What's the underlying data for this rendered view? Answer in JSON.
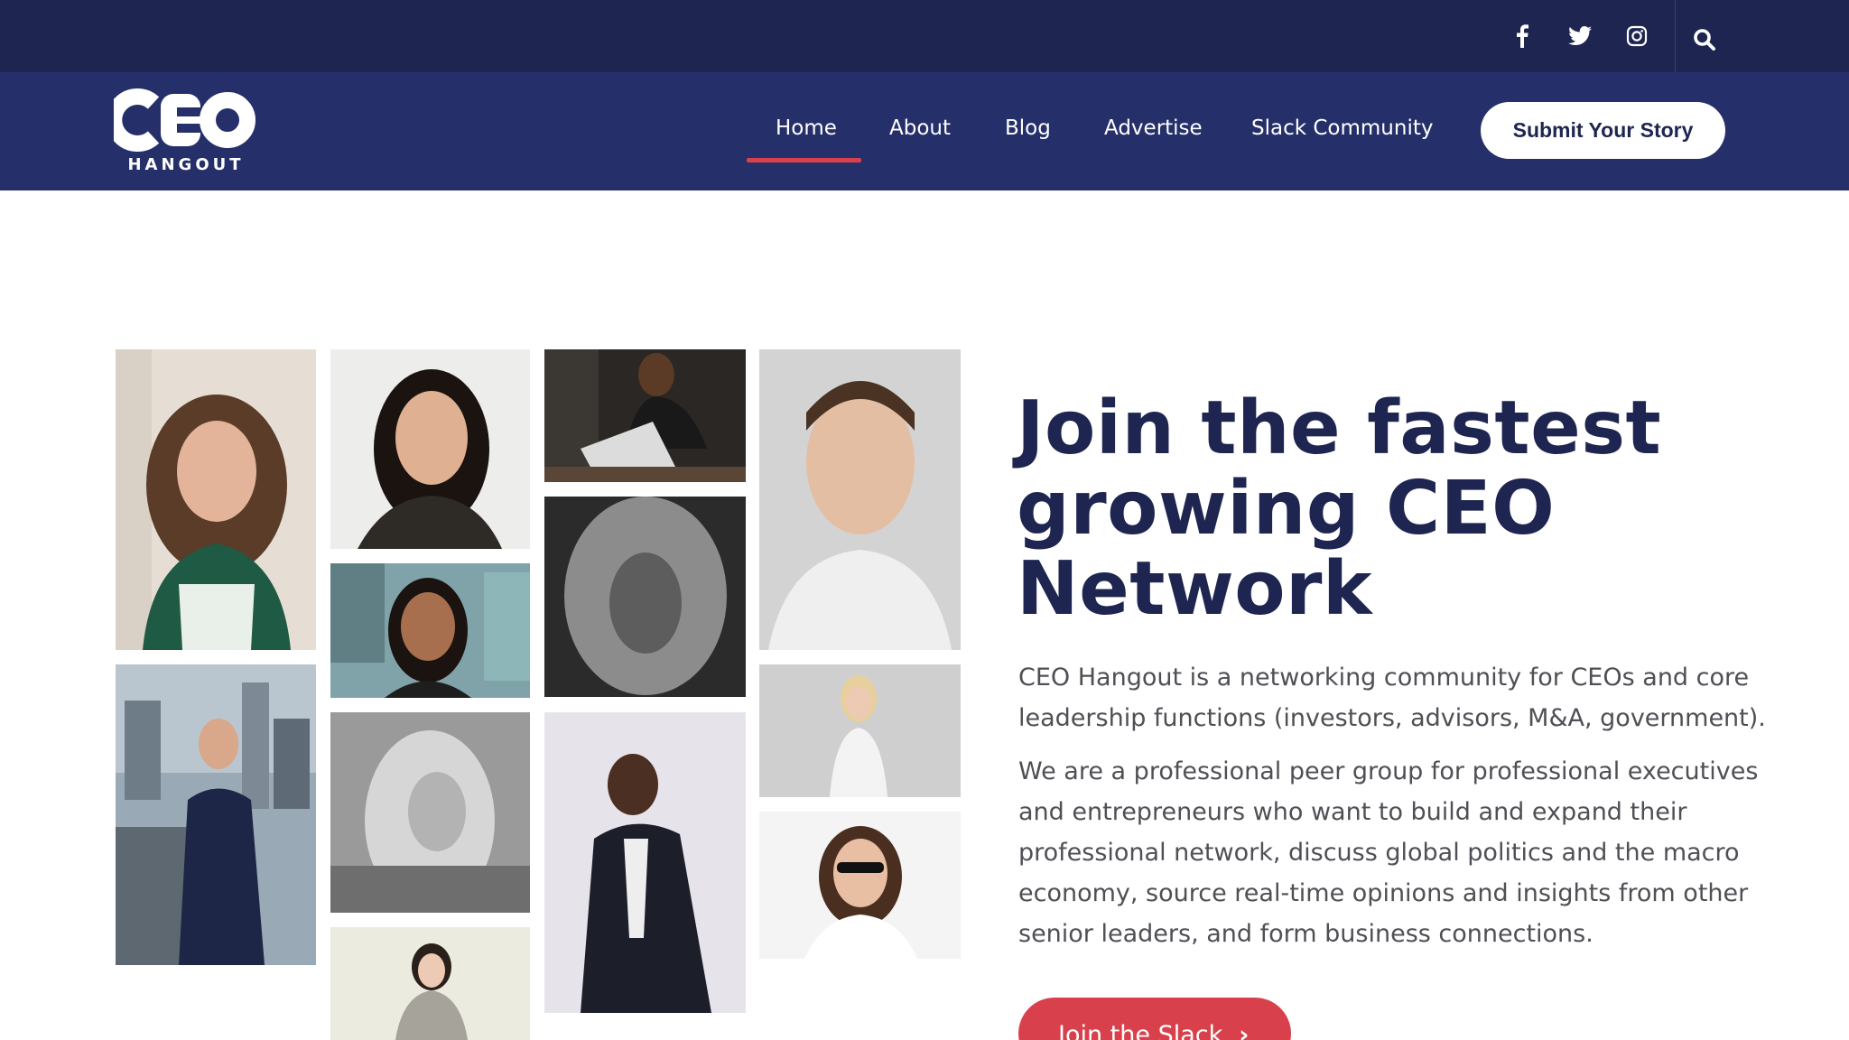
{
  "colors": {
    "topbar_bg": "#1e2550",
    "nav_bg": "#25306a",
    "accent_red": "#d8414c",
    "heading_navy": "#1e2550",
    "body_text": "#4f4f55"
  },
  "topbar": {
    "social_icons": [
      "facebook-icon",
      "twitter-icon",
      "instagram-icon"
    ],
    "search_icon": "search-icon"
  },
  "logo": {
    "main": "CEO",
    "sub": "HANGOUT"
  },
  "nav": {
    "items": [
      {
        "label": "Home",
        "active": true
      },
      {
        "label": "About",
        "active": false
      },
      {
        "label": "Blog",
        "active": false
      },
      {
        "label": "Advertise",
        "active": false
      },
      {
        "label": "Slack Community",
        "active": false
      }
    ],
    "submit_label": "Submit Your Story"
  },
  "hero": {
    "title": "Join the fastest growing CEO Network",
    "paragraph1": "CEO Hangout is a networking community for CEOs and core leadership functions (investors, advisors, M&A, government).",
    "paragraph2": "We are a professional peer group for professional executives and entrepreneurs who want to build and expand their professional network, discuss global politics and the macro economy, source real-time opinions and insights from other senior leaders, and form business connections.",
    "cta_label": "Join the Slack"
  }
}
